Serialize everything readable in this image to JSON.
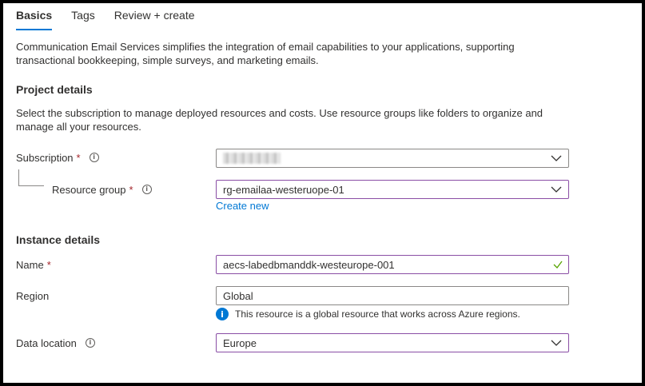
{
  "tabs": [
    "Basics",
    "Tags",
    "Review + create"
  ],
  "intro": "Communication Email Services simplifies the integration of email capabilities to your applications, supporting transactional bookkeeping, simple surveys, and marketing emails.",
  "project": {
    "heading": "Project details",
    "description": "Select the subscription to manage deployed resources and costs. Use resource groups like folders to organize and manage all your resources.",
    "subscription_label": "Subscription",
    "resource_group_label": "Resource group",
    "resource_group_value": "rg-emailaa-westeruope-01",
    "create_new": "Create new"
  },
  "instance": {
    "heading": "Instance details",
    "name_label": "Name",
    "name_value": "aecs-labedbmanddk-westeurope-001",
    "region_label": "Region",
    "region_value": "Global",
    "region_notice": "This resource is a global resource that works across Azure regions.",
    "data_location_label": "Data location",
    "data_location_value": "Europe"
  },
  "required_marker": "*",
  "colors": {
    "accent": "#0078d4",
    "required": "#a4262c",
    "focus_border": "#8a4ea5",
    "valid": "#57a300"
  }
}
